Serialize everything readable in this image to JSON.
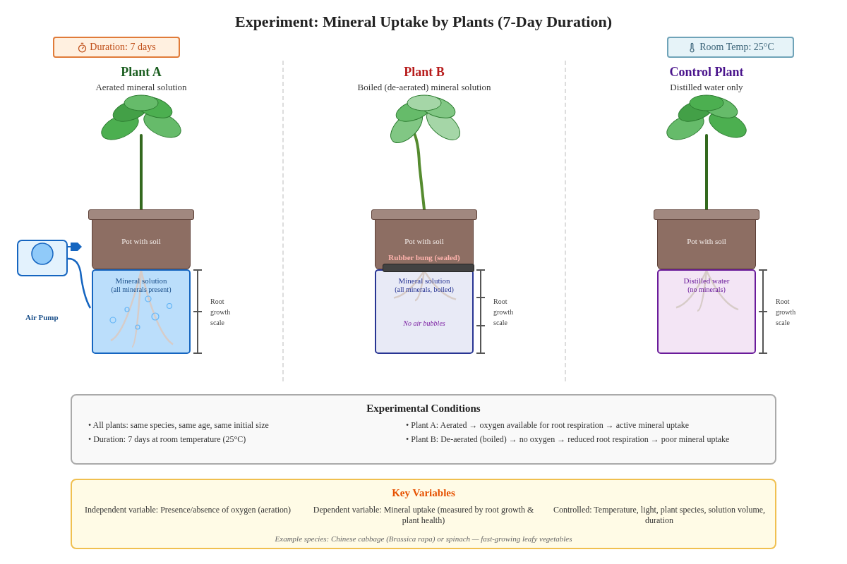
{
  "title": "Experiment: Mineral Uptake by Plants (7-Day Duration)",
  "badges": [
    {
      "kind": "timer",
      "label": "Duration: 7 days"
    },
    {
      "kind": "thermometer",
      "label": "Room Temp: 25°C"
    }
  ],
  "plants": [
    {
      "kind": "aerated",
      "name": "Plant A",
      "color": "#1b5e20",
      "subtitle": "Aerated mineral solution",
      "pot_label": "Pot with soil",
      "solution_label": "Mineral solution",
      "solution_note": "(all minerals present)",
      "scale_label": "Root growth scale",
      "pump_label": "Air Pump"
    },
    {
      "kind": "boiled",
      "name": "Plant B",
      "color": "#b71c1c",
      "subtitle": "Boiled (de-aerated) mineral solution",
      "pot_label": "Pot with soil",
      "bung_label": "Rubber bung (sealed)",
      "solution_label": "Mineral solution",
      "solution_note": "(all minerals, boiled)",
      "bottom_note": "No air bubbles",
      "scale_label": "Root growth scale"
    },
    {
      "kind": "distilled",
      "name": "Control Plant",
      "color": "#4a148c",
      "subtitle": "Distilled water only",
      "pot_label": "Pot with soil",
      "solution_label": "Distilled water",
      "solution_note": "(no minerals)",
      "scale_label": "Root growth scale"
    }
  ],
  "conditions": {
    "title": "Experimental Conditions",
    "columns": [
      [
        "• All plants: same species, same age, same initial size",
        "• Duration: 7 days at room temperature (25°C)"
      ],
      [
        "• Plant A: Aerated → oxygen available for root respiration → active mineral uptake",
        "• Plant B: De-aerated (boiled) → no oxygen → reduced root respiration → poor mineral uptake"
      ]
    ]
  },
  "key_variables": {
    "title": "Key Variables",
    "items": [
      "Independent variable: Presence/absence of oxygen (aeration)",
      "Dependent variable: Mineral uptake (measured by root growth & plant health)",
      "Controlled: Temperature, light, plant species, solution volume, duration"
    ],
    "note": "Example species: Chinese cabbage (Brassica rapa) or spinach — fast-growing leafy vegetables"
  }
}
